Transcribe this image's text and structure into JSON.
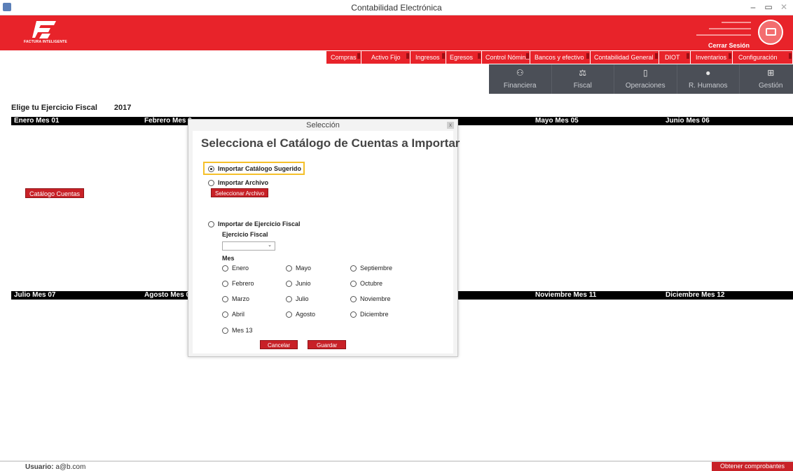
{
  "window": {
    "title": "Contabilidad Electrónica"
  },
  "brand": {
    "logo_text": "FACTURA INTELIGENTE",
    "logout": "Cerrar Sesión"
  },
  "menu": [
    "Compras",
    "Activo Fijo",
    "Ingresos",
    "Egresos",
    "Control Nómina",
    "Bancos y efectivo",
    "Contabilidad General",
    "DIOT",
    "Inventarios",
    "Configuración"
  ],
  "modules": [
    {
      "label": "Financiera",
      "icon": "coins-icon"
    },
    {
      "label": "Fiscal",
      "icon": "scale-icon"
    },
    {
      "label": "Operaciones",
      "icon": "document-icon"
    },
    {
      "label": "R. Humanos",
      "icon": "person-icon"
    },
    {
      "label": "Gestión",
      "icon": "org-chart-icon"
    }
  ],
  "fiscal": {
    "label": "Elige tu Ejercicio Fiscal",
    "year": "2017"
  },
  "months_top": [
    "Enero Mes 01",
    "Febrero Mes 0",
    "Mayo Mes 05",
    "Junio Mes 06"
  ],
  "months_bottom": [
    "Julio Mes 07",
    "Agosto Mes 0",
    "Noviembre Mes 11",
    "Diciembre Mes 12"
  ],
  "catalog_button": "Catálogo Cuentas",
  "dialog": {
    "title": "Selección",
    "close": "x",
    "heading": "Selecciona el Catálogo de Cuentas a Importar",
    "opt_sugerido": "Importar Catálogo Sugerido",
    "opt_archivo": "Importar Archivo",
    "btn_select_file": "Seleccionar Archivo",
    "opt_ejercicio": "Importar de Ejercicio Fiscal",
    "ejercicio_label": "Ejercicio Fiscal",
    "mes_label": "Mes",
    "months": [
      "Enero",
      "Mayo",
      "Septiembre",
      "Febrero",
      "Junio",
      "Octubre",
      "Marzo",
      "Julio",
      "Noviembre",
      "Abril",
      "Agosto",
      "Diciembre",
      "Mes 13"
    ],
    "cancel": "Cancelar",
    "save": "Guardar"
  },
  "status": {
    "user_label": "Usuario:",
    "user_value": "a@b.com",
    "obtain": "Obtener comprobantes"
  },
  "colors": {
    "brand_red": "#e8232a",
    "button_red": "#c82127",
    "module_bg": "#4b4f57",
    "highlight": "#f5c02a"
  }
}
